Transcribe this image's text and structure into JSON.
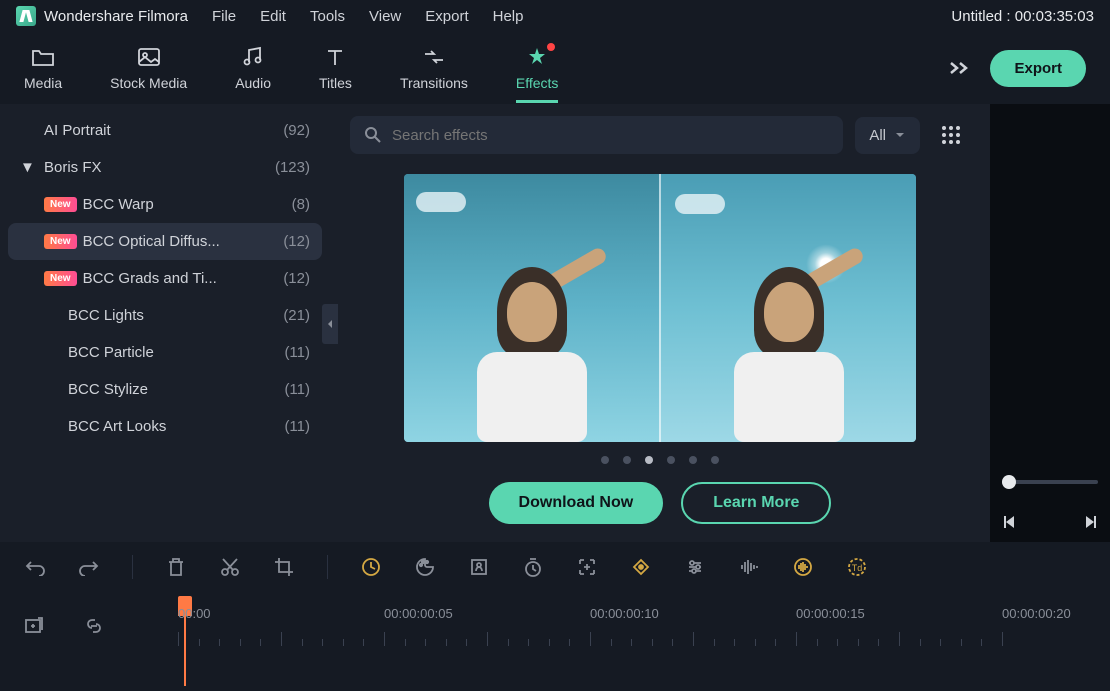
{
  "titlebar": {
    "appName": "Wondershare Filmora",
    "menu": [
      "File",
      "Edit",
      "Tools",
      "View",
      "Export",
      "Help"
    ],
    "projectStatus": "Untitled : 00:03:35:03"
  },
  "toolbar": {
    "items": [
      {
        "label": "Media"
      },
      {
        "label": "Stock Media"
      },
      {
        "label": "Audio"
      },
      {
        "label": "Titles"
      },
      {
        "label": "Transitions"
      },
      {
        "label": "Effects"
      }
    ],
    "exportLabel": "Export"
  },
  "sidebar": {
    "items": [
      {
        "label": "AI Portrait",
        "count": "(92)",
        "indent": 1,
        "new": false,
        "expanded": false,
        "selected": false
      },
      {
        "label": "Boris FX",
        "count": "(123)",
        "indent": 0,
        "new": false,
        "expanded": true,
        "selected": false,
        "chevron": true
      },
      {
        "label": "BCC Warp",
        "count": "(8)",
        "indent": 1,
        "new": true,
        "expanded": false,
        "selected": false
      },
      {
        "label": "BCC Optical Diffus...",
        "count": "(12)",
        "indent": 1,
        "new": true,
        "expanded": false,
        "selected": true
      },
      {
        "label": "BCC Grads and Ti...",
        "count": "(12)",
        "indent": 1,
        "new": true,
        "expanded": false,
        "selected": false
      },
      {
        "label": "BCC Lights",
        "count": "(21)",
        "indent": 2,
        "new": false,
        "expanded": false,
        "selected": false
      },
      {
        "label": "BCC Particle",
        "count": "(11)",
        "indent": 2,
        "new": false,
        "expanded": false,
        "selected": false
      },
      {
        "label": "BCC Stylize",
        "count": "(11)",
        "indent": 2,
        "new": false,
        "expanded": false,
        "selected": false
      },
      {
        "label": "BCC Art Looks",
        "count": "(11)",
        "indent": 2,
        "new": false,
        "expanded": false,
        "selected": false
      }
    ]
  },
  "content": {
    "searchPlaceholder": "Search effects",
    "filterLabel": "All",
    "dotsCount": 6,
    "activeDot": 2,
    "downloadLabel": "Download Now",
    "learnMoreLabel": "Learn More"
  },
  "timeline": {
    "marks": [
      {
        "label": "00:00",
        "pos": 0
      },
      {
        "label": "00:00:00:05",
        "pos": 206
      },
      {
        "label": "00:00:00:10",
        "pos": 412
      },
      {
        "label": "00:00:00:15",
        "pos": 618
      },
      {
        "label": "00:00:00:20",
        "pos": 824
      }
    ]
  }
}
